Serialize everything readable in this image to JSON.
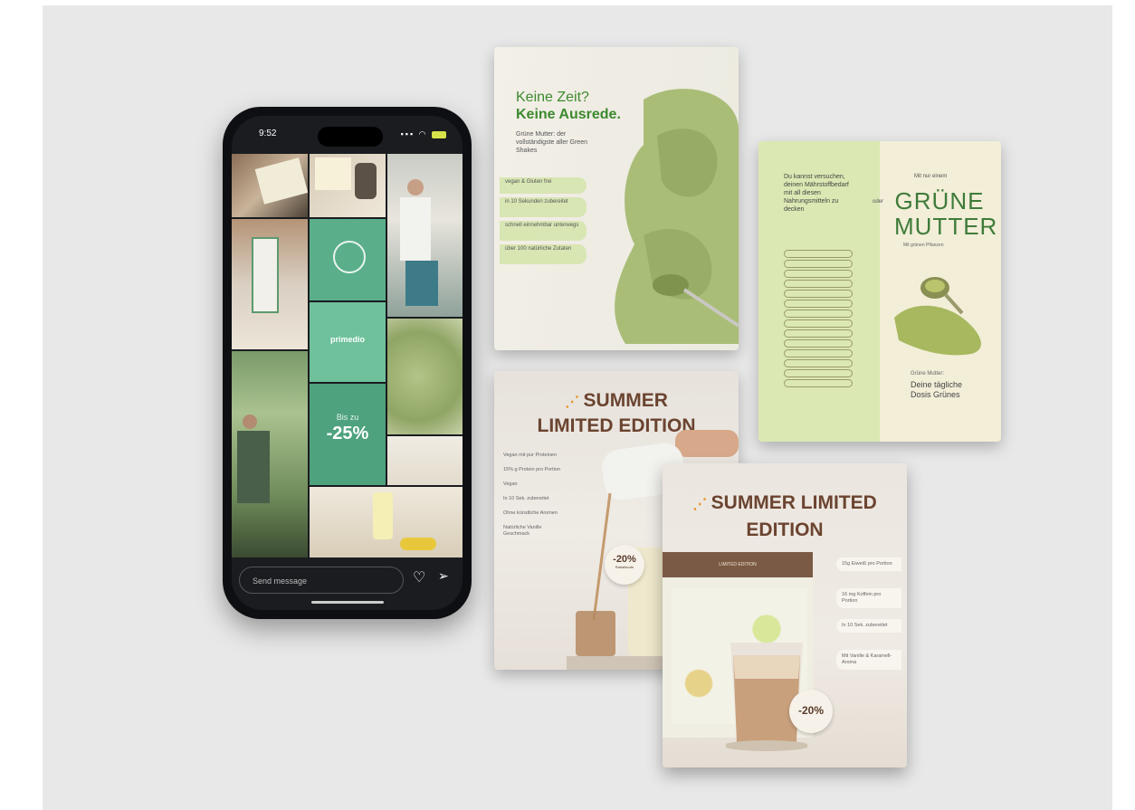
{
  "phone": {
    "time": "9:52",
    "tiles": {
      "brand_tile": "primedio",
      "discount_prefix": "Bis zu",
      "discount_value": "-25%"
    },
    "message_placeholder": "Send message",
    "icons": [
      "heart-icon",
      "send-icon"
    ]
  },
  "card_matcha": {
    "title_line1": "Keine Zeit?",
    "title_line2": "Keine Ausrede.",
    "subtitle": "Grüne Mutter: der vollständigste aller Green Shakes",
    "pills": [
      "vegan & Gluten frei",
      "in 10 Sekunden zubereitet",
      "schnell einnehmbar unterwegs",
      "über 100 natürliche Zutaten"
    ]
  },
  "card_gruene_mutter": {
    "question": "Du kannst versuchen, deinen Mährstoffbedarf mit all diesen Nahrungsmitteln zu decken",
    "or_label": "oder",
    "checklist": [
      "",
      "",
      "",
      "",
      "",
      "",
      "",
      "",
      "",
      "",
      "",
      "",
      "",
      ""
    ],
    "brand_small": "Mit nur einem",
    "brand_line1": "GRÜNE",
    "brand_line2": "MUTTER",
    "brand_tagline": "Mit grünen Pflanzen",
    "footer_small": "Grüne Mutter:",
    "footer": "Deine tägliche Dosis Grünes"
  },
  "card_summer_1": {
    "title_line1": "SUMMER",
    "title_line2": "LIMITED EDITION",
    "list": [
      "Vegan mit pur Proteinen",
      "15% g Protein pro Portion",
      "Vegan",
      "In 10 Sek. zubereitet",
      "Ohne künstliche Aromen",
      "Natürliche Vanille Geschmack"
    ],
    "badge_value": "-20%",
    "badge_sub": "Rabattcode"
  },
  "card_summer_2": {
    "title_line1": "SUMMER LIMITED",
    "title_line2": "EDITION",
    "package_label": "LIMITED EDITION",
    "list": [
      "15g Eiweiß pro Portion",
      "16 mg Koffein pro Portion",
      "In 10 Sek. zubereitet",
      "Mit Vanille & Karamell-Aroma"
    ],
    "badge_value": "-20%"
  },
  "colors": {
    "matcha_green": "#3d8a2e",
    "summer_brown": "#6b4430",
    "sun_orange": "#e39a2a",
    "phone_teal": "#5aaf8a"
  }
}
